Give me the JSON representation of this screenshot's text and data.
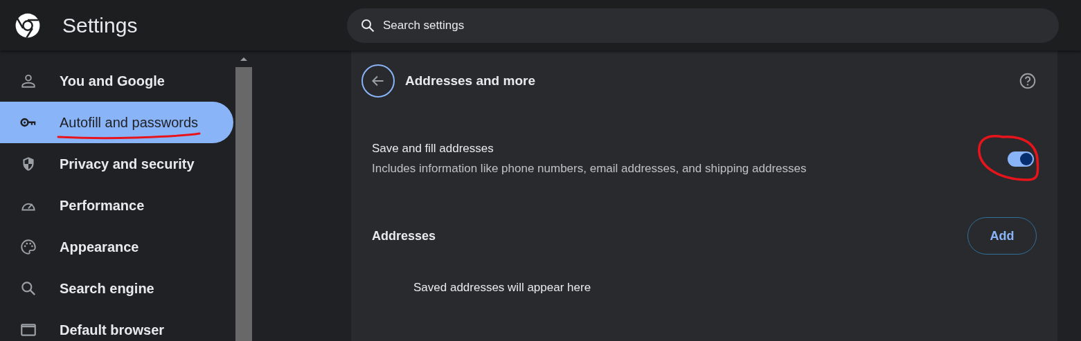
{
  "header": {
    "title": "Settings",
    "search": {
      "placeholder": "Search settings"
    }
  },
  "sidebar": {
    "items": [
      {
        "label": "You and Google",
        "selected": false
      },
      {
        "label": "Autofill and passwords",
        "selected": true
      },
      {
        "label": "Privacy and security",
        "selected": false
      },
      {
        "label": "Performance",
        "selected": false
      },
      {
        "label": "Appearance",
        "selected": false
      },
      {
        "label": "Search engine",
        "selected": false
      },
      {
        "label": "Default browser",
        "selected": false
      }
    ]
  },
  "page": {
    "title": "Addresses and more",
    "setting": {
      "title": "Save and fill addresses",
      "description": "Includes information like phone numbers, email addresses, and shipping addresses",
      "on": true
    },
    "section": {
      "title": "Addresses",
      "button": "Add",
      "empty_text": "Saved addresses will appear here"
    }
  }
}
